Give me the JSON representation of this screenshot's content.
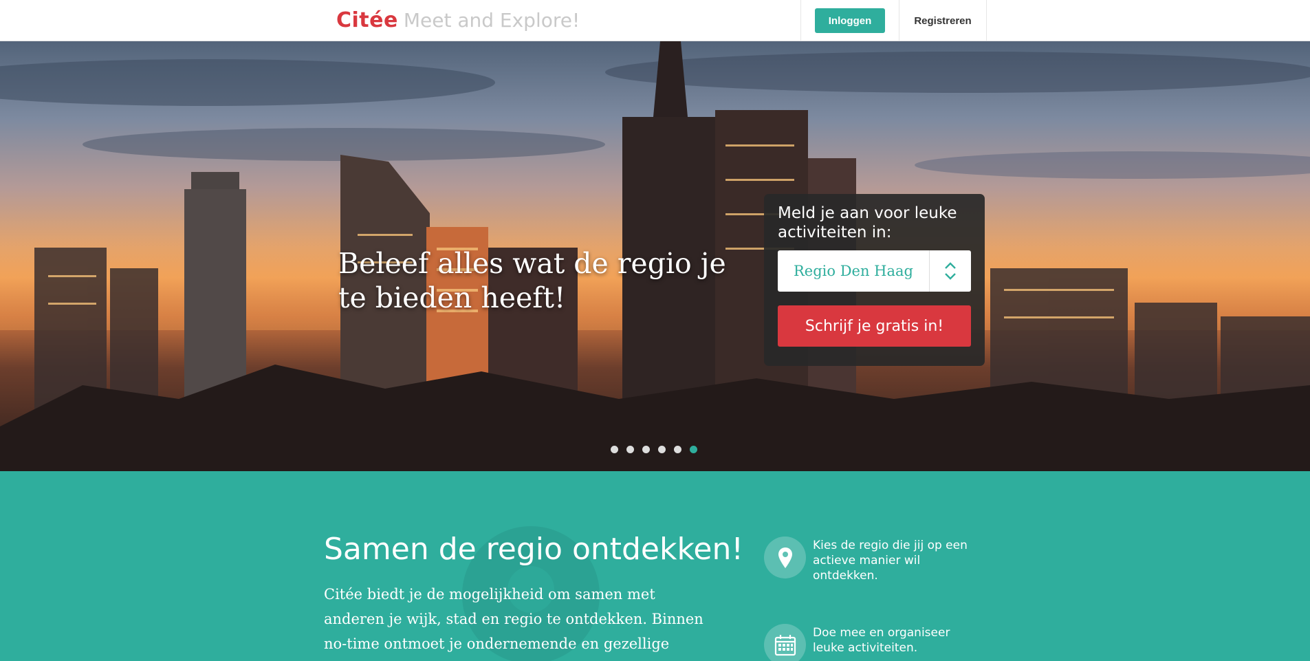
{
  "header": {
    "logo_name": "Citée",
    "logo_tagline": "Meet and Explore!",
    "login_label": "Inloggen",
    "register_label": "Registreren"
  },
  "hero": {
    "headline": "Beleef alles wat de regio je te bieden heeft!",
    "signup": {
      "title": "Meld je aan voor leuke activiteiten in:",
      "region_selected": "Regio Den Haag",
      "button_label": "Schrijf je gratis in!"
    },
    "carousel": {
      "slide_count": 6,
      "active_index": 5
    }
  },
  "intro": {
    "title": "Samen de regio ontdekken!",
    "body": "Citée biedt je de mogelijkheid om samen met anderen je wijk, stad en regio te ontdekken. Binnen no-time ontmoet je ondernemende en gezellige",
    "features": [
      {
        "icon": "map-pin-icon",
        "text": "Kies de regio die jij op een actieve manier wil ontdekken."
      },
      {
        "icon": "calendar-icon",
        "text": "Doe mee en organiseer leuke activiteiten."
      }
    ]
  },
  "colors": {
    "brand_red": "#d9383f",
    "accent_teal": "#2fae9d",
    "tagline_gray": "#c9c9c9",
    "card_dark": "#282828"
  }
}
